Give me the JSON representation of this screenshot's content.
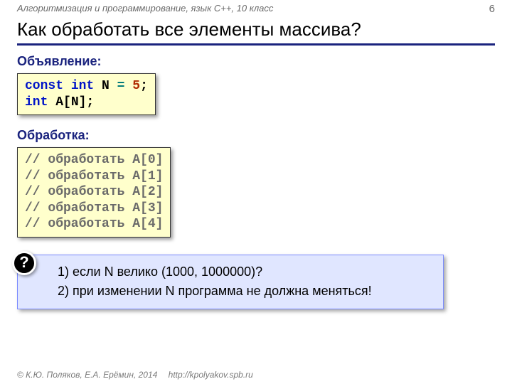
{
  "header": {
    "course": "Алгоритмизация и программирование, язык C++, 10 класс",
    "page": "6"
  },
  "title": "Как обработать все элементы массива?",
  "decl": {
    "label": "Объявление:",
    "code": {
      "l1_const": "const",
      "l1_int": "int",
      "l1_n": "N",
      "l1_eq": "=",
      "l1_val": "5",
      "l1_semi": ";",
      "l2_int": "int",
      "l2_rest": "A[N];"
    }
  },
  "proc": {
    "label": "Обработка:",
    "lines": [
      "// обработать A[0]",
      "// обработать A[1]",
      "// обработать A[2]",
      "// обработать A[3]",
      "// обработать A[4]"
    ]
  },
  "info": {
    "qmark": "?",
    "q1": "1) если N велико (1000, 1000000)?",
    "q2": "2) при изменении N программа не должна меняться!"
  },
  "footer": {
    "copy": "© К.Ю. Поляков, Е.А. Ерёмин, 2014",
    "url": "http://kpolyakov.spb.ru"
  }
}
